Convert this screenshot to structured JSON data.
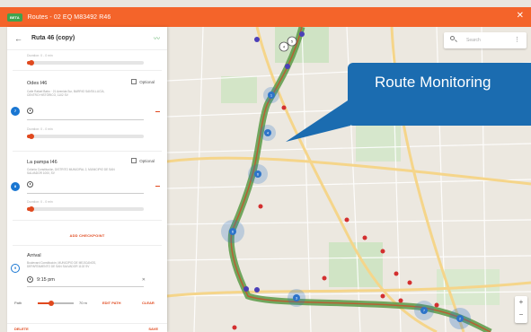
{
  "window": {
    "beta_badge": "BETA",
    "title": "Routes - 02 EQ M83492 R46",
    "close_icon": "close-icon"
  },
  "route": {
    "name": "Ruta 46 (copy)",
    "trend_icon": "trend-line-icon"
  },
  "checkpoints": [
    {
      "duration": "Duration: 0 - 0 min"
    },
    {
      "number": "7",
      "name": "Odes I46",
      "address": "Calle Rafael Batro · 21 Avenida Sur, BARRIO SANTA LUCÍA, CENTRO HISTÓRICO, 1102 SV",
      "optional_label": "Optional",
      "duration": "Duration: 0 - 0 min"
    },
    {
      "number": "8",
      "name": "La pampa I46",
      "address": "Colonia Constitución, DISTRITO MUNICIPAL 2, MUNICIPIO DE SAN SALVADOR 1000, SV",
      "optional_label": "Optional",
      "duration": "Duration: 0 - 0 min"
    }
  ],
  "add_checkpoint_label": "ADD CHECKPOINT",
  "arrival": {
    "number": "9",
    "name": "Arrival",
    "address": "Boulevard Constitución, MUNICIPIO DE MEJICANOS, DEPARTAMENTO DE SAN SALVADOR 1102 SV",
    "time": "9:15 pm",
    "clear_icon": "close-icon"
  },
  "path": {
    "label": "Path",
    "value": "70 m",
    "slider_fraction": 0.35,
    "edit_label": "EDIT PATH",
    "clear_label": "CLEAR"
  },
  "footer": {
    "delete_label": "DELETE",
    "save_label": "SAVE"
  },
  "map": {
    "search_placeholder": "Search",
    "banner_text": "Route Monitoring",
    "zoom_in": "+",
    "zoom_out": "−",
    "markers": [
      {
        "label": "1"
      },
      {
        "label": "4"
      },
      {
        "label": "6"
      },
      {
        "label": "6"
      },
      {
        "label": "3"
      },
      {
        "label": "7"
      },
      {
        "label": "2"
      },
      {
        "label": "4"
      },
      {
        "label": "5"
      }
    ],
    "colors": {
      "route_green": "#5a9a45",
      "marker_blue": "#2d74c9",
      "incident_red": "#d32f2f",
      "accent": "#f4642a"
    }
  }
}
